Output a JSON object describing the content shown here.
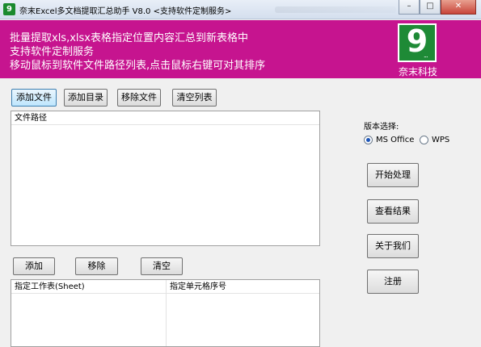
{
  "window": {
    "title": "奈末Excel多文档提取汇总助手 V8.0  <支持软件定制服务>",
    "icon_letter": "9",
    "controls": [
      "minimize",
      "maximize",
      "close"
    ],
    "control_glyphs": {
      "minimize": "–",
      "maximize": "□",
      "close": "✕"
    }
  },
  "banner": {
    "background": "#c6148f",
    "lines": [
      "批量提取xls,xlsx表格指定位置内容汇总到新表格中",
      "支持软件定制服务",
      "移动鼠标到软件文件路径列表,点击鼠标右键可对其排序"
    ],
    "logo": {
      "glyph": "9",
      "dots": "...",
      "name": "奈末科技",
      "color": "#1e8a36"
    }
  },
  "file_toolbar": {
    "add_file": "添加文件",
    "add_folder": "添加目录",
    "remove_file": "移除文件",
    "clear_list": "清空列表"
  },
  "file_list": {
    "columns": [
      "文件路径"
    ],
    "rows": []
  },
  "cell_toolbar": {
    "add": "添加",
    "remove": "移除",
    "clear": "清空"
  },
  "cell_list": {
    "columns": [
      "指定工作表(Sheet)",
      "指定单元格序号"
    ],
    "rows": []
  },
  "version": {
    "label": "版本选择:",
    "options": [
      "MS Office",
      "WPS"
    ],
    "selected": "MS Office"
  },
  "actions": {
    "start": "开始处理",
    "view_result": "查看结果",
    "about": "关于我们",
    "register": "注册"
  }
}
